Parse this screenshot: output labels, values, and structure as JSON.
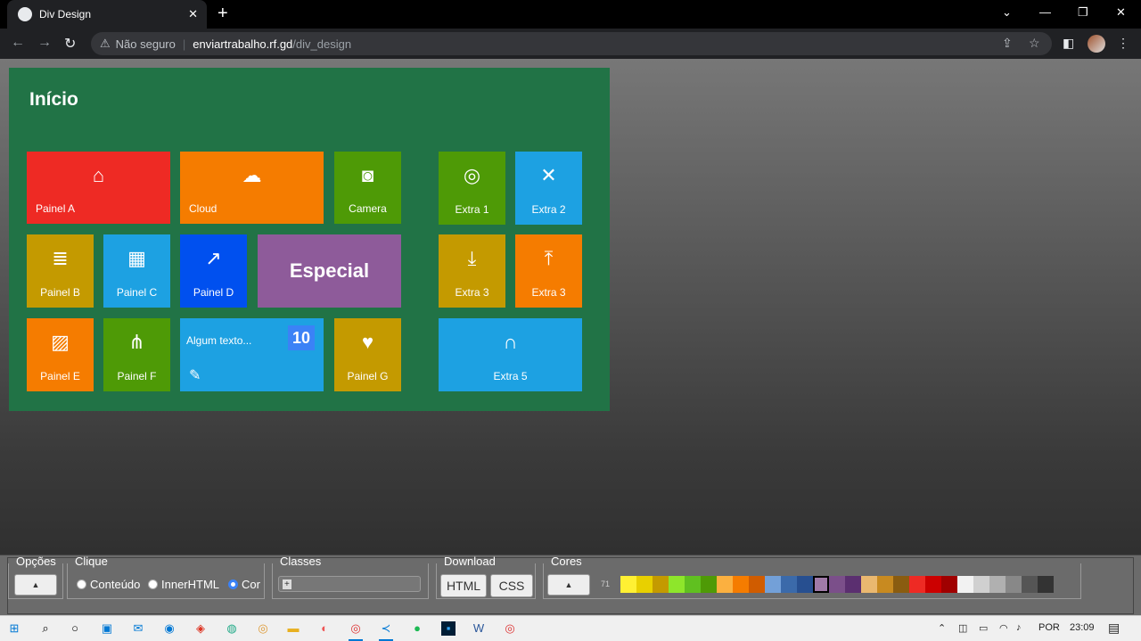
{
  "browser": {
    "tab_title": "Div Design",
    "url_warning": "Não seguro",
    "url_host": "enviartrabalho.rf.gd",
    "url_path": "/div_design"
  },
  "panel": {
    "title": "Início"
  },
  "tiles": [
    {
      "label": "Painel A",
      "icon": "home-icon",
      "color": "#ee2a24"
    },
    {
      "label": "Cloud",
      "icon": "cloud-icon",
      "color": "#f57c00"
    },
    {
      "label": "Camera",
      "icon": "camera-icon",
      "color": "#4e9a06"
    },
    {
      "label": "Extra 1",
      "icon": "ubuntu-icon",
      "color": "#4e9a06"
    },
    {
      "label": "Extra 2",
      "icon": "tools-icon",
      "color": "#1da1e2"
    },
    {
      "label": "Painel B",
      "icon": "database-icon",
      "color": "#c49a00"
    },
    {
      "label": "Painel C",
      "icon": "calendar-icon",
      "color": "#1da1e2"
    },
    {
      "label": "Painel D",
      "icon": "chart-icon",
      "color": "#0050ef"
    },
    {
      "label": "Especial",
      "icon": "",
      "color": "#8e5b9a"
    },
    {
      "label": "Extra 3",
      "icon": "download-icon",
      "color": "#c49a00"
    },
    {
      "label": "Extra 3",
      "icon": "upload-icon",
      "color": "#f57c00"
    },
    {
      "label": "Painel E",
      "icon": "image-icon",
      "color": "#f57c00"
    },
    {
      "label": "Painel F",
      "icon": "sitemap-icon",
      "color": "#4e9a06"
    },
    {
      "label": "Algum texto...",
      "icon": "edit-icon",
      "color": "#1da1e2",
      "badge": "10"
    },
    {
      "label": "Painel G",
      "icon": "heart-icon",
      "color": "#c49a00"
    },
    {
      "label": "Extra 5",
      "icon": "headphones-icon",
      "color": "#1da1e2"
    }
  ],
  "toolbar": {
    "opcoes_legend": "Opções",
    "opcoes_btn": "▲",
    "clique_legend": "Clique",
    "radio_conteudo": "Conteúdo",
    "radio_inner": "InnerHTML",
    "radio_cor": "Cor",
    "classes_legend": "Classes",
    "classes_btn": "+",
    "download_legend": "Download",
    "html_btn": "HTML",
    "css_btn": "CSS",
    "cores_legend": "Cores",
    "cores_btn": "▲",
    "cores_count": "71"
  },
  "swatches": [
    "#fff033",
    "#e8d000",
    "#c49a00",
    "#8ee62b",
    "#60c020",
    "#4e9a06",
    "#fbb040",
    "#f57c00",
    "#d05c00",
    "#73a0d8",
    "#3b6aaa",
    "#274f90",
    "#a07aa8",
    "#7b4f8a",
    "#5b2f70",
    "#eab870",
    "#c88a20",
    "#8a5c10",
    "#ee2a24",
    "#cc0000",
    "#a00000",
    "#f2f2f2",
    "#d0d0d0",
    "#b0b0b0",
    "#888888",
    "#555555",
    "#333333"
  ],
  "taskbar": {
    "lang": "POR",
    "time": "23:09"
  }
}
